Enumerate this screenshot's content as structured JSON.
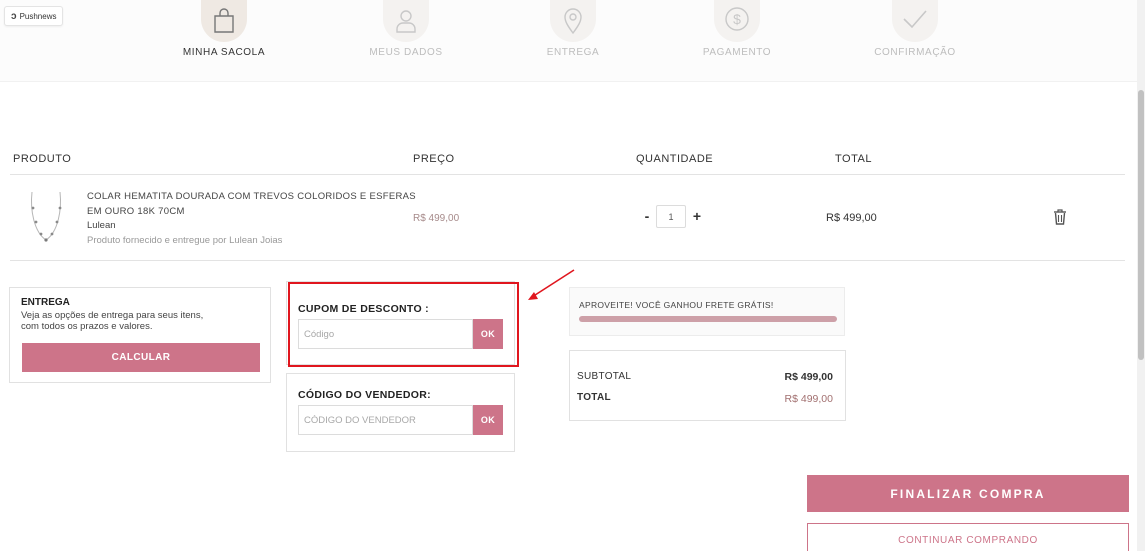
{
  "pushnews": {
    "label": "Pushnews"
  },
  "steps": [
    {
      "label": "MINHA SACOLA",
      "icon": "bag-icon",
      "active": true
    },
    {
      "label": "MEUS DADOS",
      "icon": "user-icon",
      "active": false
    },
    {
      "label": "ENTREGA",
      "icon": "location-pin-icon",
      "active": false
    },
    {
      "label": "PAGAMENTO",
      "icon": "dollar-coin-icon",
      "active": false
    },
    {
      "label": "CONFIRMAÇÃO",
      "icon": "check-icon",
      "active": false
    }
  ],
  "table": {
    "headers": {
      "product": "PRODUTO",
      "price": "PREÇO",
      "quantity": "QUANTIDADE",
      "total": "TOTAL"
    }
  },
  "cart_item": {
    "name": "COLAR HEMATITA DOURADA COM TREVOS COLORIDOS E ESFERAS EM OURO 18K 70CM",
    "brand": "Lulean",
    "seller_note": "Produto fornecido e entregue por Lulean Joias",
    "price": "R$ 499,00",
    "quantity": "1",
    "minus_label": "-",
    "plus_label": "+",
    "total": "R$ 499,00"
  },
  "shipping": {
    "title": "ENTREGA",
    "description": "Veja as opções de entrega para seus itens, com todos os prazos e valores.",
    "button_label": "CALCULAR"
  },
  "coupon": {
    "title": "CUPOM DE DESCONTO :",
    "placeholder": "Código",
    "button_label": "OK"
  },
  "seller_code": {
    "title": "CÓDIGO DO VENDEDOR:",
    "placeholder": "CÓDIGO DO VENDEDOR",
    "button_label": "OK"
  },
  "promo": {
    "text": "APROVEITE! VOCÊ GANHOU FRETE GRÁTIS!",
    "progress": 1.0
  },
  "summary": {
    "subtotal_label": "SUBTOTAL",
    "subtotal_value": "R$ 499,00",
    "total_label": "TOTAL",
    "total_value": "R$ 499,00"
  },
  "actions": {
    "checkout_label": "FINALIZAR COMPRA",
    "continue_label": "CONTINUAR COMPRANDO"
  },
  "colors": {
    "accent": "#cd7489",
    "highlight": "#e0161e",
    "progress": "#cda0a8"
  }
}
